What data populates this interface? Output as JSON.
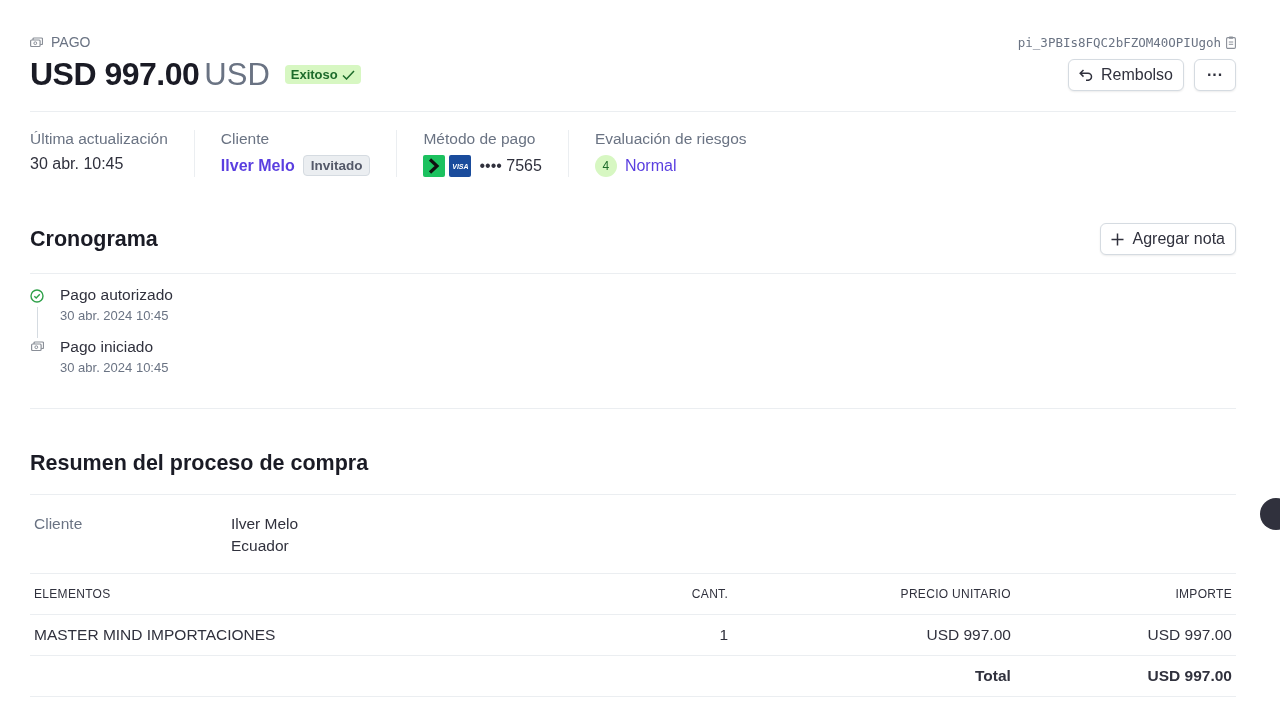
{
  "header": {
    "label": "PAGO",
    "payment_id": "pi_3PBIs8FQC2bFZOM40OPIUgoh",
    "amount": "USD 997.00",
    "currency": "USD",
    "status": "Exitoso",
    "refund_button": "Rembolso",
    "more_button": "···"
  },
  "summary": {
    "updated": {
      "label": "Última actualización",
      "value": "30 abr. 10:45"
    },
    "customer": {
      "label": "Cliente",
      "name": "Ilver Melo",
      "badge": "Invitado"
    },
    "payment_method": {
      "label": "Método de pago",
      "card_brand": "VISA",
      "last4": "•••• 7565"
    },
    "risk": {
      "label": "Evaluación de riesgos",
      "score": "4",
      "level": "Normal"
    }
  },
  "timeline": {
    "title": "Cronograma",
    "add_note_button": "Agregar nota",
    "events": [
      {
        "kind": "success",
        "title": "Pago autorizado",
        "time": "30 abr. 2024 10:45"
      },
      {
        "kind": "started",
        "title": "Pago iniciado",
        "time": "30 abr. 2024 10:45"
      }
    ]
  },
  "checkout": {
    "title": "Resumen del proceso de compra",
    "customer_label": "Cliente",
    "customer_lines": [
      "Ilver Melo",
      "Ecuador"
    ],
    "columns": [
      "ELEMENTOS",
      "CANT.",
      "PRECIO UNITARIO",
      "IMPORTE"
    ],
    "rows": [
      {
        "item": "MASTER MIND IMPORTACIONES",
        "qty": "1",
        "unit_price": "USD 997.00",
        "amount": "USD 997.00"
      }
    ],
    "total_label": "Total",
    "total": "USD 997.00"
  }
}
